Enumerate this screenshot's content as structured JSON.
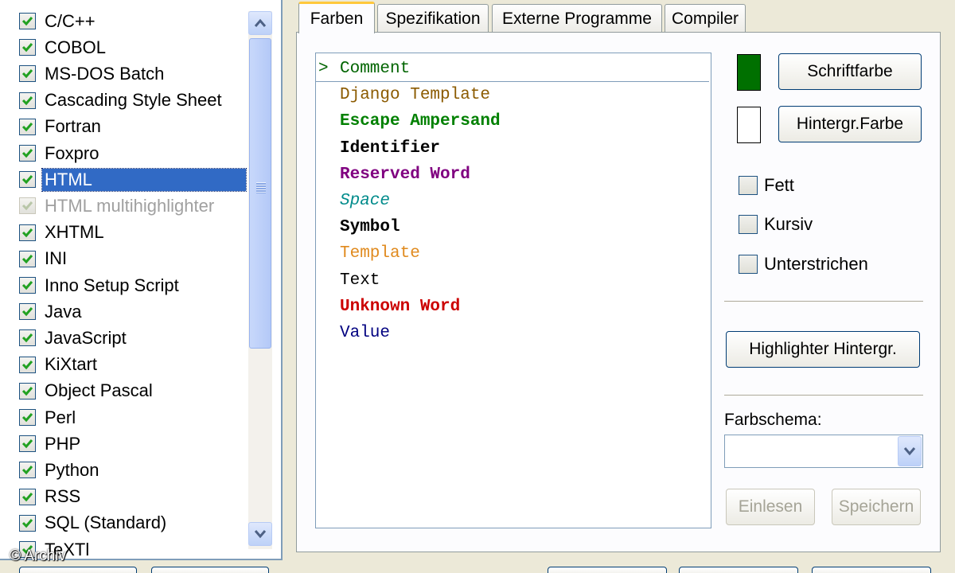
{
  "languages": [
    {
      "label": "C/C++",
      "checked": true,
      "selected": false,
      "disabled": false
    },
    {
      "label": "COBOL",
      "checked": true,
      "selected": false,
      "disabled": false
    },
    {
      "label": "MS-DOS Batch",
      "checked": true,
      "selected": false,
      "disabled": false
    },
    {
      "label": "Cascading Style Sheet",
      "checked": true,
      "selected": false,
      "disabled": false
    },
    {
      "label": "Fortran",
      "checked": true,
      "selected": false,
      "disabled": false
    },
    {
      "label": "Foxpro",
      "checked": true,
      "selected": false,
      "disabled": false
    },
    {
      "label": "HTML",
      "checked": true,
      "selected": true,
      "disabled": false
    },
    {
      "label": "HTML multihighlighter",
      "checked": true,
      "selected": false,
      "disabled": true
    },
    {
      "label": "XHTML",
      "checked": true,
      "selected": false,
      "disabled": false
    },
    {
      "label": "INI",
      "checked": true,
      "selected": false,
      "disabled": false
    },
    {
      "label": "Inno Setup Script",
      "checked": true,
      "selected": false,
      "disabled": false
    },
    {
      "label": "Java",
      "checked": true,
      "selected": false,
      "disabled": false
    },
    {
      "label": "JavaScript",
      "checked": true,
      "selected": false,
      "disabled": false
    },
    {
      "label": "KiXtart",
      "checked": true,
      "selected": false,
      "disabled": false
    },
    {
      "label": "Object Pascal",
      "checked": true,
      "selected": false,
      "disabled": false
    },
    {
      "label": "Perl",
      "checked": true,
      "selected": false,
      "disabled": false
    },
    {
      "label": "PHP",
      "checked": true,
      "selected": false,
      "disabled": false
    },
    {
      "label": "Python",
      "checked": true,
      "selected": false,
      "disabled": false
    },
    {
      "label": "RSS",
      "checked": true,
      "selected": false,
      "disabled": false
    },
    {
      "label": "SQL (Standard)",
      "checked": true,
      "selected": false,
      "disabled": false
    },
    {
      "label": "TeXTl",
      "checked": true,
      "selected": false,
      "disabled": false
    }
  ],
  "tabs": [
    {
      "label": "Farben",
      "active": true
    },
    {
      "label": "Spezifikation",
      "active": false
    },
    {
      "label": "Externe Programme",
      "active": false
    },
    {
      "label": "Compiler",
      "active": false
    }
  ],
  "tokens": [
    {
      "label": "Comment",
      "color": "#006400",
      "bold": false,
      "italic": false,
      "current": true,
      "marker": ">"
    },
    {
      "label": "Django Template",
      "color": "#8b5a00",
      "bold": false,
      "italic": false,
      "current": false,
      "marker": ""
    },
    {
      "label": "Escape Ampersand",
      "color": "#008000",
      "bold": true,
      "italic": false,
      "current": false,
      "marker": ""
    },
    {
      "label": "Identifier",
      "color": "#000000",
      "bold": true,
      "italic": false,
      "current": false,
      "marker": ""
    },
    {
      "label": "Reserved Word",
      "color": "#800080",
      "bold": true,
      "italic": false,
      "current": false,
      "marker": ""
    },
    {
      "label": "Space",
      "color": "#008b8b",
      "bold": false,
      "italic": true,
      "current": false,
      "marker": ""
    },
    {
      "label": "Symbol",
      "color": "#000000",
      "bold": true,
      "italic": false,
      "current": false,
      "marker": ""
    },
    {
      "label": "Template",
      "color": "#e08a1e",
      "bold": false,
      "italic": false,
      "current": false,
      "marker": ""
    },
    {
      "label": "Text",
      "color": "#000000",
      "bold": false,
      "italic": false,
      "current": false,
      "marker": ""
    },
    {
      "label": "Unknown Word",
      "color": "#cc0000",
      "bold": true,
      "italic": false,
      "current": false,
      "marker": ""
    },
    {
      "label": "Value",
      "color": "#000080",
      "bold": false,
      "italic": false,
      "current": false,
      "marker": ""
    }
  ],
  "controls": {
    "font_color_button": "Schriftfarbe",
    "bg_color_button": "Hintergr.Farbe",
    "font_swatch_color": "#007000",
    "bg_swatch_color": "#ffffff",
    "bold_label": "Fett",
    "italic_label": "Kursiv",
    "underline_label": "Unterstrichen",
    "highlighter_bg_button": "Highlighter Hintergr.",
    "scheme_label": "Farbschema:",
    "scheme_value": "",
    "load_button": "Einlesen",
    "save_button": "Speichern"
  },
  "copyright": "© Archiv",
  "icons": {
    "scroll_up": "chevron-up-icon",
    "scroll_down": "chevron-down-icon",
    "check": "checkmark-icon",
    "combo": "chevron-down-icon"
  }
}
